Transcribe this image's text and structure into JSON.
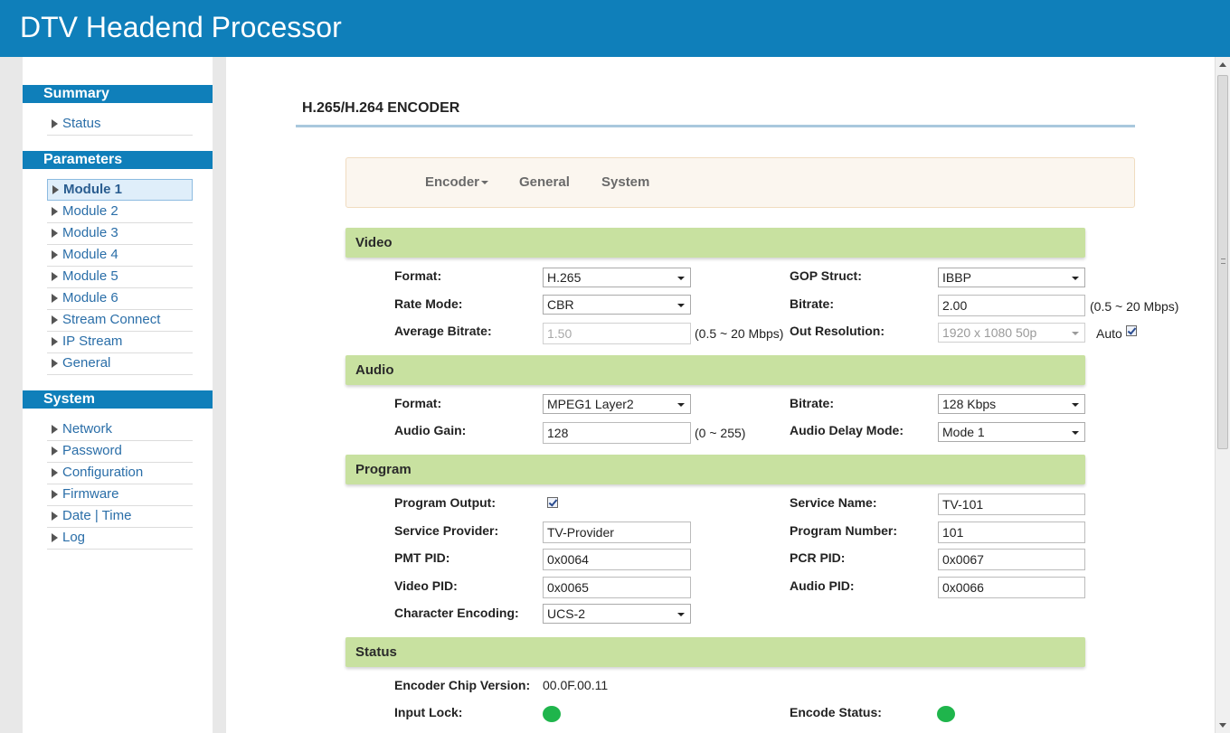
{
  "app": {
    "title": "DTV Headend Processor"
  },
  "sidebar": {
    "summary": {
      "header": "Summary",
      "items": [
        {
          "label": "Status"
        }
      ]
    },
    "parameters": {
      "header": "Parameters",
      "items": [
        {
          "label": "Module 1",
          "active": true
        },
        {
          "label": "Module 2"
        },
        {
          "label": "Module 3"
        },
        {
          "label": "Module 4"
        },
        {
          "label": "Module 5"
        },
        {
          "label": "Module 6"
        },
        {
          "label": "Stream Connect"
        },
        {
          "label": "IP Stream"
        },
        {
          "label": "General"
        }
      ]
    },
    "system": {
      "header": "System",
      "items": [
        {
          "label": "Network"
        },
        {
          "label": "Password"
        },
        {
          "label": "Configuration"
        },
        {
          "label": "Firmware"
        },
        {
          "label": "Date | Time"
        },
        {
          "label": "Log"
        }
      ]
    }
  },
  "main": {
    "title": "H.265/H.264 ENCODER",
    "tabs": [
      {
        "label": "Encoder",
        "dropdown": true
      },
      {
        "label": "General"
      },
      {
        "label": "System"
      }
    ],
    "video": {
      "header": "Video",
      "format": {
        "label": "Format:",
        "value": "H.265"
      },
      "gop_struct": {
        "label": "GOP Struct:",
        "value": "IBBP"
      },
      "rate_mode": {
        "label": "Rate Mode:",
        "value": "CBR"
      },
      "bitrate": {
        "label": "Bitrate:",
        "value": "2.00",
        "hint": "(0.5 ~ 20 Mbps)"
      },
      "avg_bitrate": {
        "label": "Average Bitrate:",
        "value": "1.50",
        "hint": "(0.5 ~ 20 Mbps)"
      },
      "out_resolution": {
        "label": "Out Resolution:",
        "value": "1920 x 1080 50p",
        "auto_label": "Auto",
        "auto_checked": true
      }
    },
    "audio": {
      "header": "Audio",
      "format": {
        "label": "Format:",
        "value": "MPEG1 Layer2"
      },
      "bitrate": {
        "label": "Bitrate:",
        "value": "128 Kbps"
      },
      "gain": {
        "label": "Audio Gain:",
        "value": "128",
        "hint": "(0 ~ 255)"
      },
      "delay_mode": {
        "label": "Audio Delay Mode:",
        "value": "Mode 1"
      }
    },
    "program": {
      "header": "Program",
      "output": {
        "label": "Program Output:",
        "checked": true
      },
      "service_name": {
        "label": "Service Name:",
        "value": "TV-101"
      },
      "service_provider": {
        "label": "Service Provider:",
        "value": "TV-Provider"
      },
      "program_number": {
        "label": "Program Number:",
        "value": "101"
      },
      "pmt_pid": {
        "label": "PMT PID:",
        "value": "0x0064"
      },
      "pcr_pid": {
        "label": "PCR PID:",
        "value": "0x0067"
      },
      "video_pid": {
        "label": "Video PID:",
        "value": "0x0065"
      },
      "audio_pid": {
        "label": "Audio PID:",
        "value": "0x0066"
      },
      "char_encoding": {
        "label": "Character Encoding:",
        "value": "UCS-2"
      }
    },
    "status": {
      "header": "Status",
      "chip_version": {
        "label": "Encoder Chip Version:",
        "value": "00.0F.00.11"
      },
      "input_lock": {
        "label": "Input Lock:"
      },
      "encode_status": {
        "label": "Encode Status:"
      },
      "led_color": "#1fb54c"
    }
  },
  "colors": {
    "brand": "#0f7fba",
    "panel_header": "#c8e1a0",
    "link": "#2a6ea8"
  }
}
